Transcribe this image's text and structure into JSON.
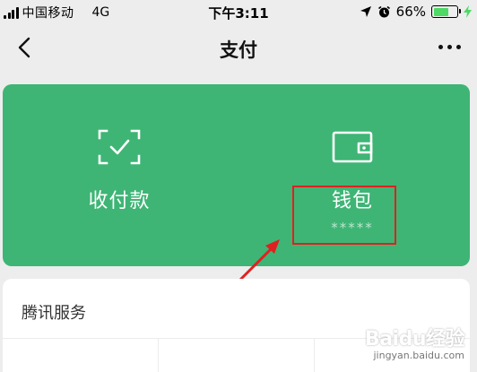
{
  "status_bar": {
    "carrier": "中国移动",
    "network": "4G",
    "time": "下午3:11",
    "battery_percent": "66%",
    "battery_level": 0.66
  },
  "nav": {
    "title": "支付"
  },
  "pay_card": {
    "color": "#3eb575",
    "receive_pay": {
      "label": "收付款",
      "icon": "scan-qr-icon"
    },
    "wallet": {
      "label": "钱包",
      "balance_masked": "*****",
      "icon": "wallet-icon"
    }
  },
  "services": {
    "title": "腾讯服务"
  },
  "watermark": {
    "brand": "Baidu经验",
    "url": "jingyan.baidu.com"
  }
}
